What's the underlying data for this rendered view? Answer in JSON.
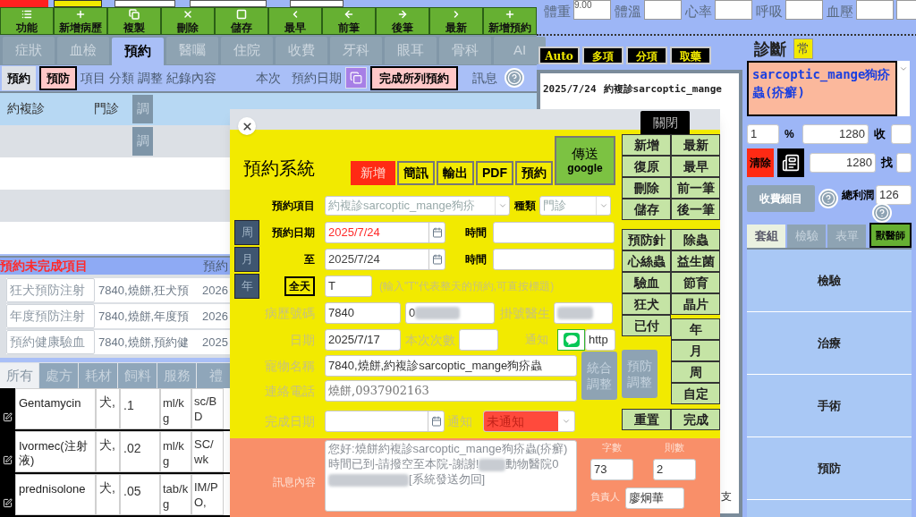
{
  "vitals": [
    {
      "label": "體重",
      "value": "9.00"
    },
    {
      "label": "體溫"
    },
    {
      "label": "心率"
    },
    {
      "label": "呼吸"
    },
    {
      "label": "血壓"
    }
  ],
  "toolbar": [
    "功能",
    "新增病歷",
    "複製",
    "刪除",
    "儲存",
    "最早",
    "前筆",
    "後筆",
    "最新",
    "新增預約"
  ],
  "tabs": [
    {
      "label": "症狀",
      "selected": false
    },
    {
      "label": "血檢",
      "selected": false
    },
    {
      "label": "預約",
      "selected": true
    },
    {
      "label": "醫囑",
      "selected": false
    },
    {
      "label": "住院",
      "selected": false
    },
    {
      "label": "收費",
      "selected": false
    },
    {
      "label": "牙科",
      "selected": false
    },
    {
      "label": "眼耳",
      "selected": false
    },
    {
      "label": "骨科",
      "selected": false
    },
    {
      "label": "AI",
      "selected": false
    }
  ],
  "subheader": {
    "buttons": [
      {
        "label": "預約",
        "selected": false
      },
      {
        "label": "預防",
        "selected": true
      }
    ],
    "columns": [
      "項目",
      "分類",
      "調整",
      "紀錄內容",
      "本次",
      "預約日期"
    ],
    "complete_button": "完成所列預約",
    "message_label": "訊息"
  },
  "appointments": [
    {
      "item": "約複診",
      "category": "門診",
      "adjust": "調"
    },
    {
      "adjust": "調"
    }
  ],
  "pending": {
    "title": "預約未完成項目",
    "column": "預約",
    "rows": [
      {
        "item": "狂犬預防注射",
        "content": "7840,燒餅,狂犬預",
        "date": "2026"
      },
      {
        "item": "年度預防注射",
        "content": "7840,燒餅,年度預",
        "date": "2026"
      },
      {
        "item": "預約健康驗血",
        "content": "7840,燒餅,預約健",
        "date": "2025"
      }
    ]
  },
  "bottom_tabs": [
    {
      "label": "所有",
      "selected": true
    },
    {
      "label": "處方",
      "selected": false
    },
    {
      "label": "耗材",
      "selected": false
    },
    {
      "label": "飼料",
      "selected": false
    },
    {
      "label": "服務",
      "selected": false
    },
    {
      "label": "禮",
      "selected": false
    }
  ],
  "drugs": [
    {
      "name": "Gentamycin",
      "species": "犬,",
      "dose": ".1",
      "unit": "ml/kg",
      "route": "sc/BD"
    },
    {
      "name": "Ivormec(注射液)",
      "species": "犬,",
      "dose": ".02",
      "unit": "ml/kg",
      "route": "SC/wk"
    },
    {
      "name": "prednisolone",
      "species": "犬,",
      "dose": ".05",
      "unit": "tab/kg",
      "route": "IM/PO,"
    }
  ],
  "record_buttons": [
    "Auto",
    "多項",
    "分項",
    "取藥"
  ],
  "record_row": {
    "date": "2025/7/24",
    "content": "約複診sarcoptic_mange"
  },
  "stray_text": "支",
  "diagnosis": {
    "label": "診斷",
    "badge": "常",
    "value": "sarcoptic_mange狗疥蟲(疥癬)"
  },
  "billing": {
    "rate": "1",
    "percent": "%",
    "amount": "1280",
    "receive": "收",
    "clear": "清除",
    "amount2": "1280",
    "change": "找",
    "detail": "收費細目",
    "profit_label": "總利潤",
    "profit": "126"
  },
  "right_tabs": [
    {
      "label": "套組",
      "selected": true
    },
    {
      "label": "檢驗",
      "selected": false
    },
    {
      "label": "表單",
      "selected": false
    }
  ],
  "vet_button": "獸醫師",
  "categories": [
    "檢驗",
    "治療",
    "手術",
    "預防"
  ],
  "modal": {
    "title": "預約系統",
    "close_button": "關閉",
    "actions": [
      {
        "label": "新增",
        "selected": true
      },
      {
        "label": "簡訊",
        "selected": false
      },
      {
        "label": "輸出",
        "selected": false
      },
      {
        "label": "PDF",
        "selected": false
      },
      {
        "label": "預約",
        "selected": false
      }
    ],
    "send": {
      "label": "傳送",
      "sub": "google"
    },
    "item_label": "預約項目",
    "item_value": "約複診sarcoptic_mange狗疥",
    "type_label": "種類",
    "type_value": "門診",
    "date_label": "預約日期",
    "date_value": "2025/7/24",
    "time_label": "時間",
    "to_label": "至",
    "to_value": "2025/7/24",
    "time2_label": "時間",
    "allday_button": "全天",
    "allday_value": "T",
    "allday_hint": "(輸入\"T\"代表整天的預約,可直按標題)",
    "period_side": [
      "周",
      "月",
      "年"
    ],
    "record_label": "病歷號碼",
    "record_value": "7840",
    "record_extra": "0",
    "doctor_label": "掛號醫生",
    "visit_label": "日期",
    "visit_value": "2025/7/17",
    "count_label": "本次次數",
    "notify_label": "通知",
    "link_value": "http",
    "pet_label": "寵物名稱",
    "pet_value": "7840,燒餅,約複診sarcoptic_mange狗疥蟲",
    "phone_label": "連絡電話",
    "phone_value": "燒餅,0937902163",
    "adjust_buttons": [
      {
        "label": "統合調整",
        "disabled": true
      },
      {
        "label": "預防調整",
        "disabled": true
      }
    ],
    "done_label": "完成日期",
    "notify2_label": "通知",
    "notify2_value": "未通知",
    "message_label": "訊息內容",
    "message_parts": [
      "您好:燒餅約複診sarcoptic_mange狗疥蟲(疥癬)時間已到-請撥空至本院-謝謝!",
      "動物醫院0",
      "[系統發送勿回]"
    ],
    "chars_label": "字數",
    "chars_value": "73",
    "count2_label": "則數",
    "count2_value": "2",
    "owner_label": "負責人",
    "owner_value": "廖炯華",
    "nav_buttons": [
      "新增",
      "最新",
      "復原",
      "最早",
      "刪除",
      "前一筆",
      "儲存",
      "後一筆"
    ],
    "quick_buttons": [
      "預防針",
      "除蟲",
      "心絲蟲",
      "益生菌",
      "驗血",
      "節育",
      "狂犬",
      "晶片"
    ],
    "paid_button": "已付",
    "period_buttons": [
      "年",
      "月",
      "周",
      "自定"
    ],
    "reset_button": "重置",
    "finish_button": "完成"
  }
}
